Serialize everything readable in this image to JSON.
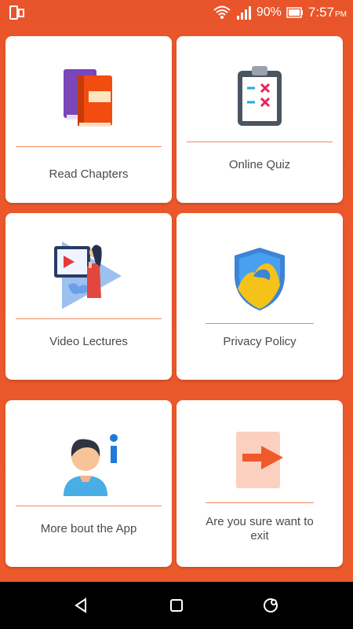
{
  "status_bar": {
    "battery_percent": "90%",
    "time": "7:57",
    "ampm": "PM",
    "icons": [
      "phone-screen-icon",
      "wifi-icon",
      "signal-icon",
      "battery-icon"
    ]
  },
  "menu": {
    "items": [
      {
        "label": "Read Chapters",
        "icon": "books-icon"
      },
      {
        "label": "Online Quiz",
        "icon": "clipboard-quiz-icon"
      },
      {
        "label": "Video Lectures",
        "icon": "video-lecture-icon"
      },
      {
        "label": "Privacy Policy",
        "icon": "shield-icon"
      },
      {
        "label": "More bout the App",
        "icon": "user-info-icon"
      },
      {
        "label_line1": "Are you sure want to",
        "label_line2": "exit",
        "icon": "exit-arrow-icon"
      }
    ]
  },
  "colors": {
    "accent": "#e8552a",
    "divider": "#f08a5d",
    "card_bg": "#ffffff",
    "text": "#4a4a4a"
  },
  "nav_bar": {
    "icons": [
      "back-icon",
      "home-icon",
      "recents-icon"
    ]
  }
}
